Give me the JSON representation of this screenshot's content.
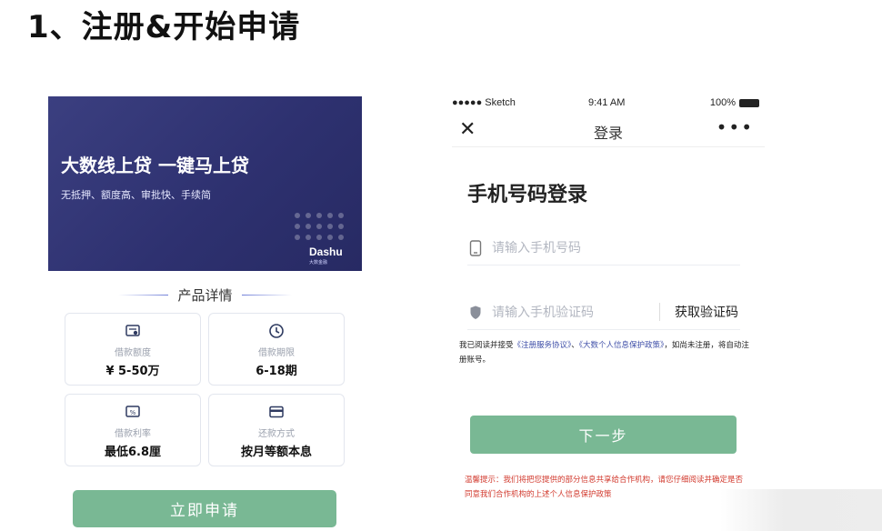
{
  "heading": "1、注册&开始申请",
  "product": {
    "banner": {
      "title": "大数线上贷 一键马上贷",
      "subtitle": "无抵押、额度高、审批快、手续简",
      "logo": "Dashu",
      "logo_sub": "大数金融",
      "bg_color": "#2f3272"
    },
    "section_title": "产品详情",
    "cards": [
      {
        "icon": "quota-icon",
        "label": "借款额度",
        "value": "¥ 5-50万"
      },
      {
        "icon": "clock-icon",
        "label": "借款期限",
        "value": "6-18期"
      },
      {
        "icon": "rate-icon",
        "label": "借款利率",
        "value": "最低6.8厘"
      },
      {
        "icon": "card-icon",
        "label": "还款方式",
        "value": "按月等额本息"
      }
    ],
    "apply_label": "立即申请"
  },
  "login": {
    "status_bar": {
      "carrier": "●●●●● Sketch",
      "time": "9:41 AM",
      "battery": "100%"
    },
    "nav": {
      "close": "✕",
      "title": "登录",
      "more": "•••"
    },
    "title": "手机号码登录",
    "phone_placeholder": "请输入手机号码",
    "code_placeholder": "请输入手机验证码",
    "get_code_label": "获取验证码",
    "agreement": {
      "prefix": "我已阅读并接受",
      "link1": "《注册服务协议》",
      "sep": "、",
      "link2": "《大数个人信息保护政策》",
      "suffix": "，如尚未注册，将自动注册账号。"
    },
    "next_label": "下一步",
    "tip": "温馨提示：我们将把您提供的部分信息共享给合作机构，请您仔细阅读并确定是否同意我们合作机构的上述个人信息保护政策"
  },
  "colors": {
    "accent_green": "#79b894",
    "banner": "#2f3272",
    "tip_red": "#d23a2e",
    "link_blue": "#3f4fa8"
  }
}
